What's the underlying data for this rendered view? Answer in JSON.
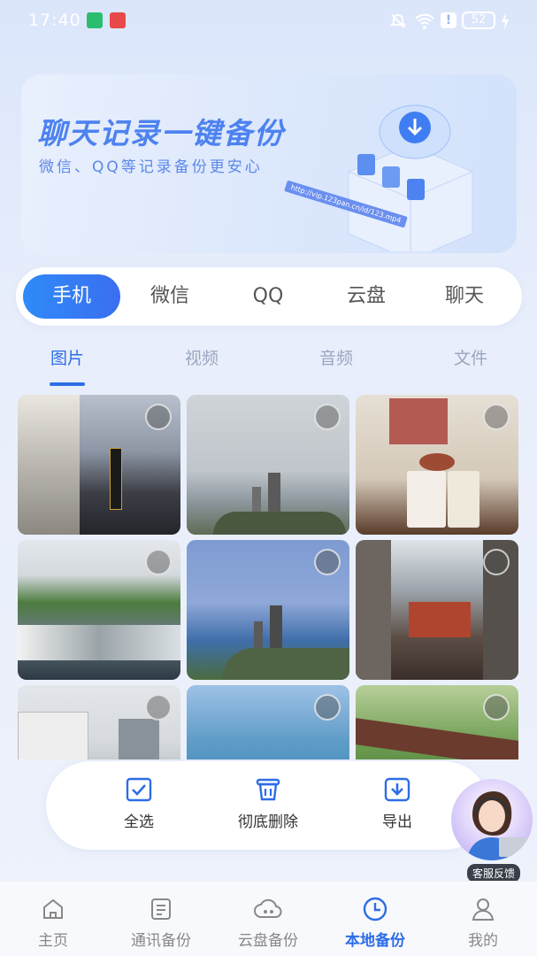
{
  "status_bar": {
    "time": "17:40",
    "battery": "52"
  },
  "banner": {
    "title": "聊天记录一键备份",
    "subtitle": "微信、QQ等记录备份更安心",
    "url": "http://vip.123pan.cn/id/123.mp4"
  },
  "main_tabs": [
    {
      "label": "手机",
      "active": true
    },
    {
      "label": "微信",
      "active": false
    },
    {
      "label": "QQ",
      "active": false
    },
    {
      "label": "云盘",
      "active": false
    },
    {
      "label": "聊天",
      "active": false
    }
  ],
  "sub_tabs": [
    {
      "label": "图片",
      "active": true
    },
    {
      "label": "视频",
      "active": false
    },
    {
      "label": "音频",
      "active": false
    },
    {
      "label": "文件",
      "active": false
    }
  ],
  "action_bar": {
    "select_all": "全选",
    "delete": "彻底删除",
    "export": "导出"
  },
  "assistant": {
    "label": "客服反馈"
  },
  "bottom_nav": [
    {
      "label": "主页",
      "icon": "home-icon",
      "active": false
    },
    {
      "label": "通讯备份",
      "icon": "contacts-icon",
      "active": false
    },
    {
      "label": "云盘备份",
      "icon": "cloud-icon",
      "active": false
    },
    {
      "label": "本地备份",
      "icon": "clock-icon",
      "active": true
    },
    {
      "label": "我的",
      "icon": "person-icon",
      "active": false
    }
  ],
  "colors": {
    "accent": "#2d6de6",
    "banner_title": "#4d82f0"
  }
}
